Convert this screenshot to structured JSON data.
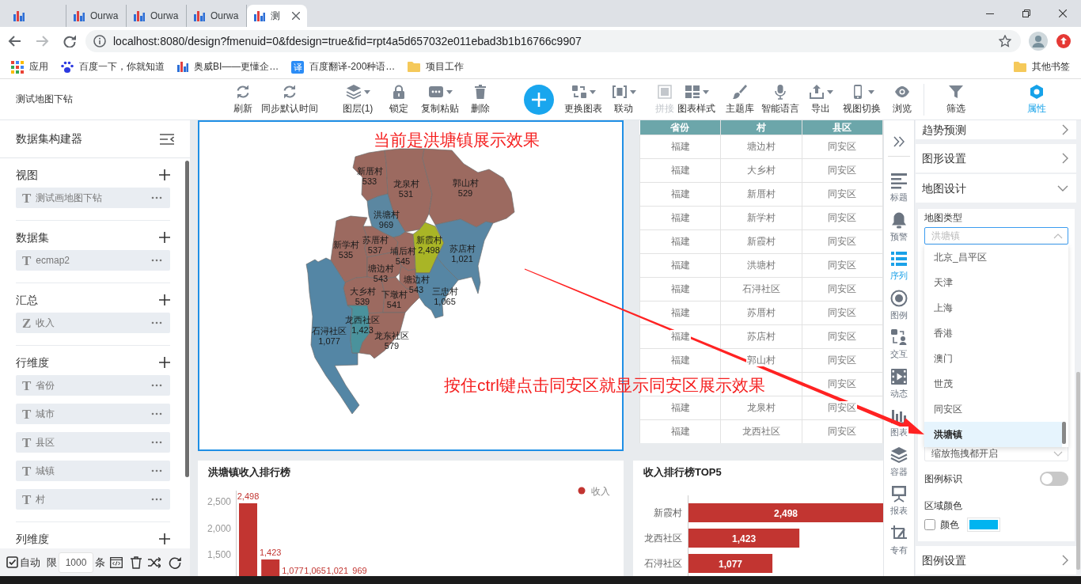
{
  "browser": {
    "tabs": [
      {
        "selected": false
      },
      {
        "title": "Ourwa",
        "selected": false
      },
      {
        "title": "Ourwa",
        "selected": false
      },
      {
        "title": "Ourwa",
        "selected": false
      },
      {
        "title": "测",
        "selected": true
      }
    ],
    "url": "localhost:8080/design?fmenuid=0&fdesign=true&fid=rpt4a5d657032e011ebad3b1b16766c9907",
    "bookmarks": [
      {
        "label": "应用"
      },
      {
        "label": "百度一下，你就知道"
      },
      {
        "label": "奥威BI——更懂企…"
      },
      {
        "glyph": "译",
        "label": "百度翻译-200种语…"
      },
      {
        "label": "项目工作"
      }
    ],
    "other_bookmarks": "其他书签"
  },
  "app": {
    "title": "测试地图下钻",
    "toolbar": [
      {
        "kind": "tool",
        "label": "刷新",
        "dropdown": false,
        "disabled": false,
        "selected": false
      },
      {
        "kind": "tool",
        "label": "同步默认时间",
        "dropdown": false,
        "disabled": false,
        "selected": false
      },
      {
        "kind": "tool",
        "label": "图层(1)",
        "dropdown": true,
        "disabled": false,
        "selected": false
      },
      {
        "kind": "tool",
        "label": "锁定",
        "dropdown": false,
        "disabled": false,
        "selected": false
      },
      {
        "kind": "tool",
        "label": "复制粘贴",
        "dropdown": true,
        "disabled": false,
        "selected": false
      },
      {
        "kind": "tool",
        "label": "删除",
        "dropdown": false,
        "disabled": false,
        "selected": false
      },
      {
        "kind": "add"
      },
      {
        "kind": "tool",
        "label": "更换图表",
        "dropdown": true,
        "disabled": false,
        "selected": false
      },
      {
        "kind": "tool",
        "label": "联动",
        "dropdown": true,
        "disabled": false,
        "selected": false
      },
      {
        "kind": "tool",
        "label": "拼接",
        "dropdown": false,
        "disabled": true,
        "selected": false
      },
      {
        "kind": "tool",
        "label": "图表样式",
        "dropdown": true,
        "disabled": false,
        "selected": false
      },
      {
        "kind": "tool",
        "label": "主题库",
        "dropdown": false,
        "disabled": false,
        "selected": false
      },
      {
        "kind": "tool",
        "label": "智能语言",
        "dropdown": false,
        "disabled": false,
        "selected": false
      },
      {
        "kind": "tool",
        "label": "导出",
        "dropdown": true,
        "disabled": false,
        "selected": false
      },
      {
        "kind": "tool",
        "label": "视图切换",
        "dropdown": true,
        "disabled": false,
        "selected": false
      },
      {
        "kind": "tool",
        "label": "浏览",
        "dropdown": false,
        "disabled": false,
        "selected": false
      },
      {
        "kind": "tool",
        "label": "筛选",
        "dropdown": false,
        "disabled": false,
        "selected": false
      },
      {
        "kind": "tool",
        "label": "属性",
        "dropdown": false,
        "disabled": false,
        "selected": true
      }
    ]
  },
  "sidebar": {
    "title": "数据集构建器",
    "sections": [
      {
        "title": "视图",
        "items": [
          {
            "glyph": "T",
            "label": "测试画地图下钻"
          }
        ]
      },
      {
        "title": "数据集",
        "items": [
          {
            "glyph": "T",
            "label": "ecmap2"
          }
        ]
      },
      {
        "title": "汇总",
        "items": [
          {
            "glyph": "Z",
            "label": "收入"
          }
        ]
      },
      {
        "title": "行维度",
        "items": [
          {
            "glyph": "T",
            "label": "省份"
          },
          {
            "glyph": "T",
            "label": "城市"
          },
          {
            "glyph": "T",
            "label": "县区"
          },
          {
            "glyph": "T",
            "label": "城镇"
          },
          {
            "glyph": "T",
            "label": "村"
          }
        ]
      },
      {
        "title": "列维度"
      }
    ],
    "footer": {
      "auto": {
        "label": "自动",
        "checked": true
      },
      "limit_label": "限",
      "limit": "1000",
      "unit": "条"
    }
  },
  "map_panel": {
    "annotation": "当前是洪塘镇展示效果",
    "regions": [
      {
        "name": "新厝村",
        "value": "533",
        "color": "#9c6a60"
      },
      {
        "name": "龙泉村",
        "value": "531",
        "color": "#9c6a60"
      },
      {
        "name": "郭山村",
        "value": "529",
        "color": "#9c6a60"
      },
      {
        "name": "洪塘村",
        "value": "969",
        "color": "#5b87a1"
      },
      {
        "name": "新学村",
        "value": "535",
        "color": "#9c6a60"
      },
      {
        "name": "苏厝村",
        "value": "537",
        "color": "#9c6a60"
      },
      {
        "name": "埔后村",
        "value": "545",
        "color": "#9c6a60"
      },
      {
        "name": "新霞村",
        "value": "2,498",
        "color": "#a9b526"
      },
      {
        "name": "苏店村",
        "value": "1,021",
        "color": "#5886a3"
      },
      {
        "name": "塘边村",
        "value": "543",
        "color": "#9c6a60"
      },
      {
        "name": "大乡村",
        "value": "539",
        "color": "#9c6a60"
      },
      {
        "name": "下墩村",
        "value": "541",
        "color": "#9c6a60"
      },
      {
        "name": "塘边村",
        "value": "543",
        "color": "#9c6a60"
      },
      {
        "name": "三忠村",
        "value": "1,065",
        "color": "#5686a4"
      },
      {
        "name": "石浔社区",
        "value": "1,077",
        "color": "#5486a5"
      },
      {
        "name": "龙西社区",
        "value": "1,423",
        "color": "#4a929c"
      },
      {
        "name": "龙东社区",
        "value": "579",
        "color": "#9c6a60"
      }
    ]
  },
  "table": {
    "columns": [
      "省份",
      "村",
      "县区"
    ],
    "rows": [
      [
        "福建",
        "塘边村",
        "同安区"
      ],
      [
        "福建",
        "大乡村",
        "同安区"
      ],
      [
        "福建",
        "新厝村",
        "同安区"
      ],
      [
        "福建",
        "新学村",
        "同安区"
      ],
      [
        "福建",
        "新霞村",
        "同安区"
      ],
      [
        "福建",
        "洪塘村",
        "同安区"
      ],
      [
        "福建",
        "石浔社区",
        "同安区"
      ],
      [
        "福建",
        "苏厝村",
        "同安区"
      ],
      [
        "福建",
        "苏店村",
        "同安区"
      ],
      [
        "福建",
        "郭山村",
        "同安区"
      ],
      [
        null,
        null,
        "同安区"
      ],
      [
        "福建",
        "龙泉村",
        "同安区"
      ],
      [
        "福建",
        "龙西社区",
        "同安区"
      ]
    ]
  },
  "annotation": {
    "text": "按住ctrl键点击同安区就显示同安区展示效果"
  },
  "income_chart": {
    "title": "洪塘镇收入排行榜",
    "legend": {
      "label": "收入",
      "color": "#c23531"
    },
    "axis_labels": [
      "2,500",
      "2,000",
      "1,500"
    ],
    "bar_labels": [
      "2,498",
      "1,423",
      "1,077",
      "1,065",
      "1,021",
      "969"
    ]
  },
  "top5_chart": {
    "title": "收入排行榜TOP5",
    "chart_data": {
      "type": "bar",
      "orientation": "horizontal",
      "categories": [
        "新霞村",
        "龙西社区",
        "石浔社区"
      ],
      "values": [
        2498,
        1423,
        1077
      ],
      "value_labels": [
        "2,498",
        "1,423",
        "1,077"
      ]
    }
  },
  "side_tabs": [
    {
      "label": "标题",
      "selected": false
    },
    {
      "label": "预警",
      "selected": false
    },
    {
      "label": "序列",
      "selected": true
    },
    {
      "label": "图例",
      "selected": false
    },
    {
      "label": "交互",
      "selected": false
    },
    {
      "label": "动态",
      "selected": false
    },
    {
      "label": "图表",
      "selected": false
    },
    {
      "label": "容器",
      "selected": false
    },
    {
      "label": "报表",
      "selected": false
    },
    {
      "label": "专有",
      "selected": false
    }
  ],
  "properties": {
    "sections": [
      {
        "title": "趋势预测",
        "expanded": false
      },
      {
        "title": "图形设置",
        "expanded": false
      },
      {
        "title": "地图设计",
        "expanded": true
      },
      {
        "title": "图例设置",
        "expanded": false
      }
    ],
    "map_design": {
      "map_type": {
        "label": "地图类型",
        "placeholder": "洪塘镇",
        "expanded": true,
        "options": [
          {
            "label": "北京_昌平区",
            "selected": false
          },
          {
            "label": "天津",
            "selected": false
          },
          {
            "label": "上海",
            "selected": false
          },
          {
            "label": "香港",
            "selected": false
          },
          {
            "label": "澳门",
            "selected": false
          },
          {
            "label": "世茂",
            "selected": false
          },
          {
            "label": "同安区",
            "selected": false
          },
          {
            "label": "洪塘镇",
            "selected": true
          }
        ]
      },
      "zoom_mode": "缩放拖拽都开启",
      "legend_marker": {
        "label": "图例标识",
        "on": false
      },
      "region_color": {
        "label": "区域颜色",
        "checkbox_label": "颜色",
        "checked": false,
        "color": "#00b4f0"
      }
    }
  }
}
